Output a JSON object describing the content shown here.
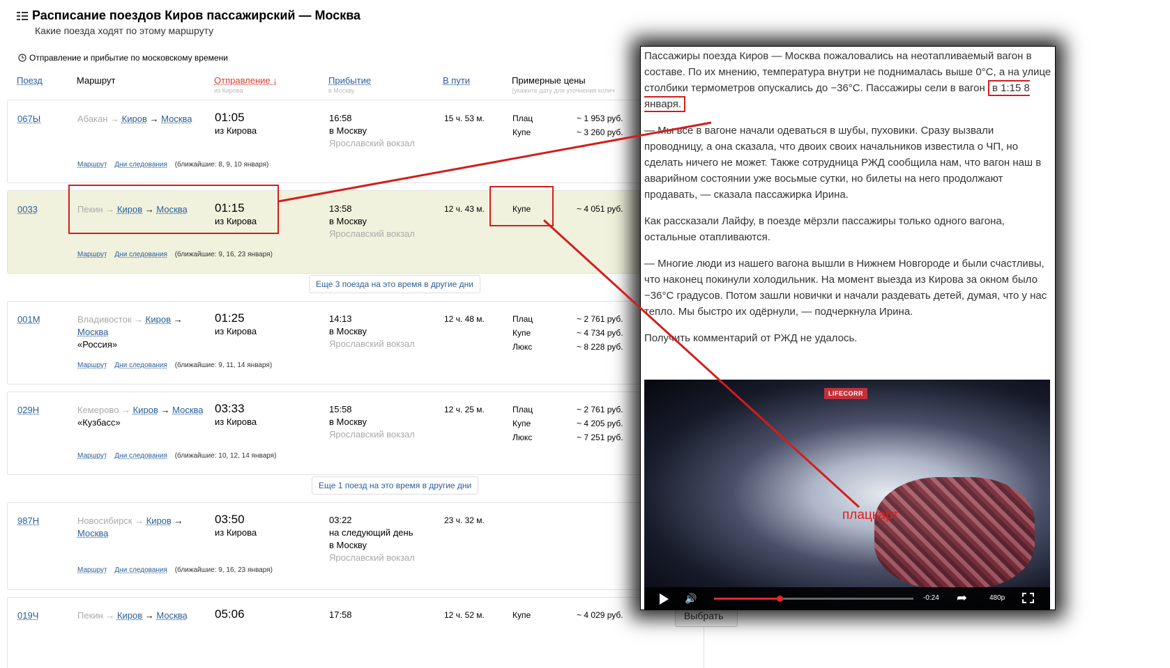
{
  "header": {
    "title": "Расписание поездов Киров пассажирский — Москва",
    "subtitle": "Какие поезда ходят по этому маршруту",
    "tz_note": "Отправление и прибытие по московскому времени"
  },
  "columns": {
    "train": "Поезд",
    "route": "Маршрут",
    "departure": "Отправление ↓",
    "departure_sub": "из Кирова",
    "arrival": "Прибытие",
    "arrival_sub": "в Москву",
    "duration": "В пути",
    "prices": "Примерные цены",
    "prices_sub": "(укажите дату для уточнения колич"
  },
  "trains": [
    {
      "number": "067Ы",
      "origin": "Абакан →",
      "via": "Киров",
      "arrow2": "→",
      "dest": "Москва",
      "name": "",
      "dep_time": "01:05",
      "dep_from": "из Кирова",
      "arr_time": "16:58",
      "arr_extra": "",
      "arr_to": "в Москву",
      "station": "Ярославский вокзал",
      "duration": "15 ч. 53 м.",
      "classes": [
        "Плац",
        "Купе"
      ],
      "prices": [
        "~ 1 953 руб.",
        "~ 3 260 руб."
      ],
      "route_link": "Маршрут",
      "days_link": "Дни следования",
      "days": "(ближайшие: 8, 9, 10 января)"
    },
    {
      "number": "0033",
      "origin": "Пекин →",
      "via": "Киров",
      "arrow2": "→",
      "dest": "Москва",
      "name": "",
      "dep_time": "01:15",
      "dep_from": "из Кирова",
      "arr_time": "13:58",
      "arr_extra": "",
      "arr_to": "в Москву",
      "station": "Ярославский вокзал",
      "duration": "12 ч. 43 м.",
      "classes": [
        "Купе"
      ],
      "prices": [
        "~ 4 051 руб."
      ],
      "route_link": "Маршрут",
      "days_link": "Дни следования",
      "days": "(ближайшие: 9, 16, 23 января)"
    },
    {
      "number": "001М",
      "origin": "Владивосток →",
      "via": "Киров",
      "arrow2": "→",
      "dest": "Москва",
      "name": "«Россия»",
      "dep_time": "01:25",
      "dep_from": "из Кирова",
      "arr_time": "14:13",
      "arr_extra": "",
      "arr_to": "в Москву",
      "station": "Ярославский вокзал",
      "duration": "12 ч. 48 м.",
      "classes": [
        "Плац",
        "Купе",
        "Люкс"
      ],
      "prices": [
        "~ 2 761 руб.",
        "~ 4 734 руб.",
        "~ 8 228 руб."
      ],
      "route_link": "Маршрут",
      "days_link": "Дни следования",
      "days": "(ближайшие: 9, 11, 14 января)"
    },
    {
      "number": "029Н",
      "origin": "Кемерово →",
      "via": "Киров",
      "arrow2": "→",
      "dest": "Москва",
      "name": "«Кузбасс»",
      "dep_time": "03:33",
      "dep_from": "из Кирова",
      "arr_time": "15:58",
      "arr_extra": "",
      "arr_to": "в Москву",
      "station": "Ярославский вокзал",
      "duration": "12 ч. 25 м.",
      "classes": [
        "Плац",
        "Купе",
        "Люкс"
      ],
      "prices": [
        "~ 2 761 руб.",
        "~ 4 205 руб.",
        "~ 7 251 руб."
      ],
      "route_link": "Маршрут",
      "days_link": "Дни следования",
      "days": "(ближайшие: 10, 12, 14 января)"
    },
    {
      "number": "987Н",
      "origin": "Новосибирск →",
      "via": "Киров",
      "arrow2": "→",
      "dest": "Москва",
      "name": "",
      "dep_time": "03:50",
      "dep_from": "из Кирова",
      "arr_time": "03:22",
      "arr_extra": "на следующий день",
      "arr_to": "в Москву",
      "station": "Ярославский вокзал",
      "duration": "23 ч. 32 м.",
      "classes": [],
      "prices": [],
      "route_link": "Маршрут",
      "days_link": "Дни следования",
      "days": "(ближайшие: 9, 16, 23 января)"
    },
    {
      "number": "019Ч",
      "origin": "Пекин →",
      "via": "Киров",
      "arrow2": "→",
      "dest": "Москва",
      "name": "",
      "dep_time": "05:06",
      "dep_from": "",
      "arr_time": "17:58",
      "arr_extra": "",
      "arr_to": "",
      "station": "",
      "duration": "12 ч. 52 м.",
      "classes": [
        "Купе"
      ],
      "prices": [
        "~ 4 029 руб."
      ],
      "route_link": "",
      "days_link": "",
      "days": ""
    }
  ],
  "more_buttons": [
    "Еще 3 поезда на это время в другие дни",
    "Еще 1 поезд на это время в другие дни"
  ],
  "choose_button": "Выбрать",
  "article": {
    "p1_before": "Пассажиры поезда Киров — Москва пожаловались на неотапливаемый вагон в составе. По их мнению, температура внутри не поднималась выше 0°С, а на улице столбики термометров опускались до −36°С. Пассажиры сели в вагон",
    "p1_highlight": "в 1:15 8 января.",
    "p2": "— Мы все в вагоне начали одеваться в шубы, пуховики. Сразу вызвали проводницу, а она сказала, что двоих своих начальников известила о ЧП, но сделать ничего не может. Также сотрудница РЖД сообщила нам, что вагон наш в аварийном состоянии уже восьмые сутки, но билеты на него продолжают продавать, — сказала пассажирка Ирина.",
    "p3": "Как рассказали Лайфу, в поезде мёрзли пассажиры только одного вагона, остальные отапливаются.",
    "p4": "— Многие люди из нашего вагона вышли в Нижнем Новгороде и были счастливы, что наконец покинули холодильник. На момент выезда из Кирова за окном было −36°С градусов. Потом зашли новички и начали раздевать детей, думая, что у нас тепло. Мы быстро их одёрнули, — подчеркнула Ирина.",
    "p5": "Получить комментарий от РЖД не удалось."
  },
  "video": {
    "logo": "LIFECORR",
    "caption": "плацкарт",
    "time": "-0:24",
    "quality": "480p",
    "progress": 0.33
  }
}
